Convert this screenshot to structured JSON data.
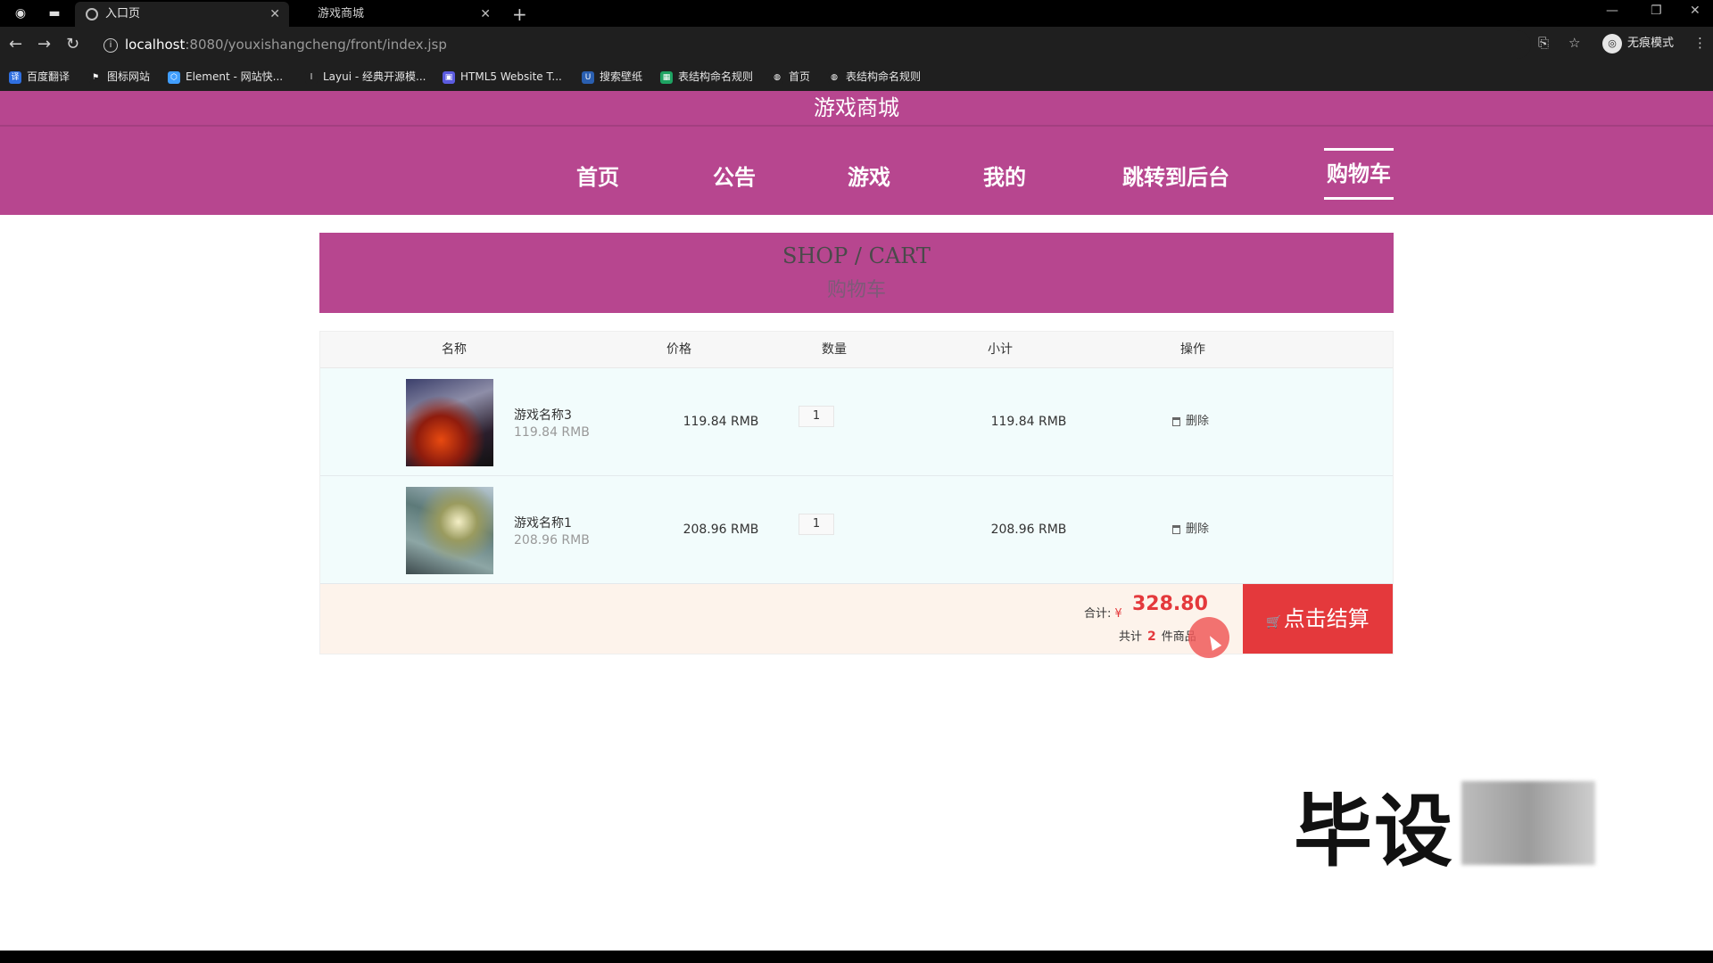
{
  "browser": {
    "tabs": [
      {
        "title": "入口页",
        "active": true
      },
      {
        "title": "游戏商城",
        "active": false
      }
    ],
    "url_host": "localhost",
    "url_path": ":8080/youxishangcheng/front/index.jsp",
    "incognito_label": "无痕模式",
    "bookmarks": [
      "百度翻译",
      "图标网站",
      "Element - 网站快...",
      "Layui - 经典开源模...",
      "HTML5 Website T...",
      "搜索壁纸",
      "表结构命名规则",
      "首页",
      "表结构命名规则"
    ]
  },
  "site": {
    "title": "游戏商城",
    "nav": [
      "首页",
      "公告",
      "游戏",
      "我的",
      "跳转到后台",
      "购物车"
    ],
    "active_nav": "购物车"
  },
  "banner": {
    "en": "SHOP / CART",
    "zh": "购物车"
  },
  "cart": {
    "headers": [
      "名称",
      "价格",
      "数量",
      "小计",
      "操作"
    ],
    "items": [
      {
        "name": "游戏名称3",
        "unit_price": "119.84 RMB",
        "price": "119.84 RMB",
        "qty": "1",
        "subtotal": "119.84 RMB",
        "action": "删除"
      },
      {
        "name": "游戏名称1",
        "unit_price": "208.96 RMB",
        "price": "208.96 RMB",
        "qty": "1",
        "subtotal": "208.96 RMB",
        "action": "删除"
      }
    ],
    "total_label": "合计:",
    "currency": "¥",
    "total": "328.80",
    "count_prefix": "共计",
    "count": "2",
    "count_suffix": "件商品",
    "checkout_label": "点击结算"
  },
  "watermark": "毕设"
}
